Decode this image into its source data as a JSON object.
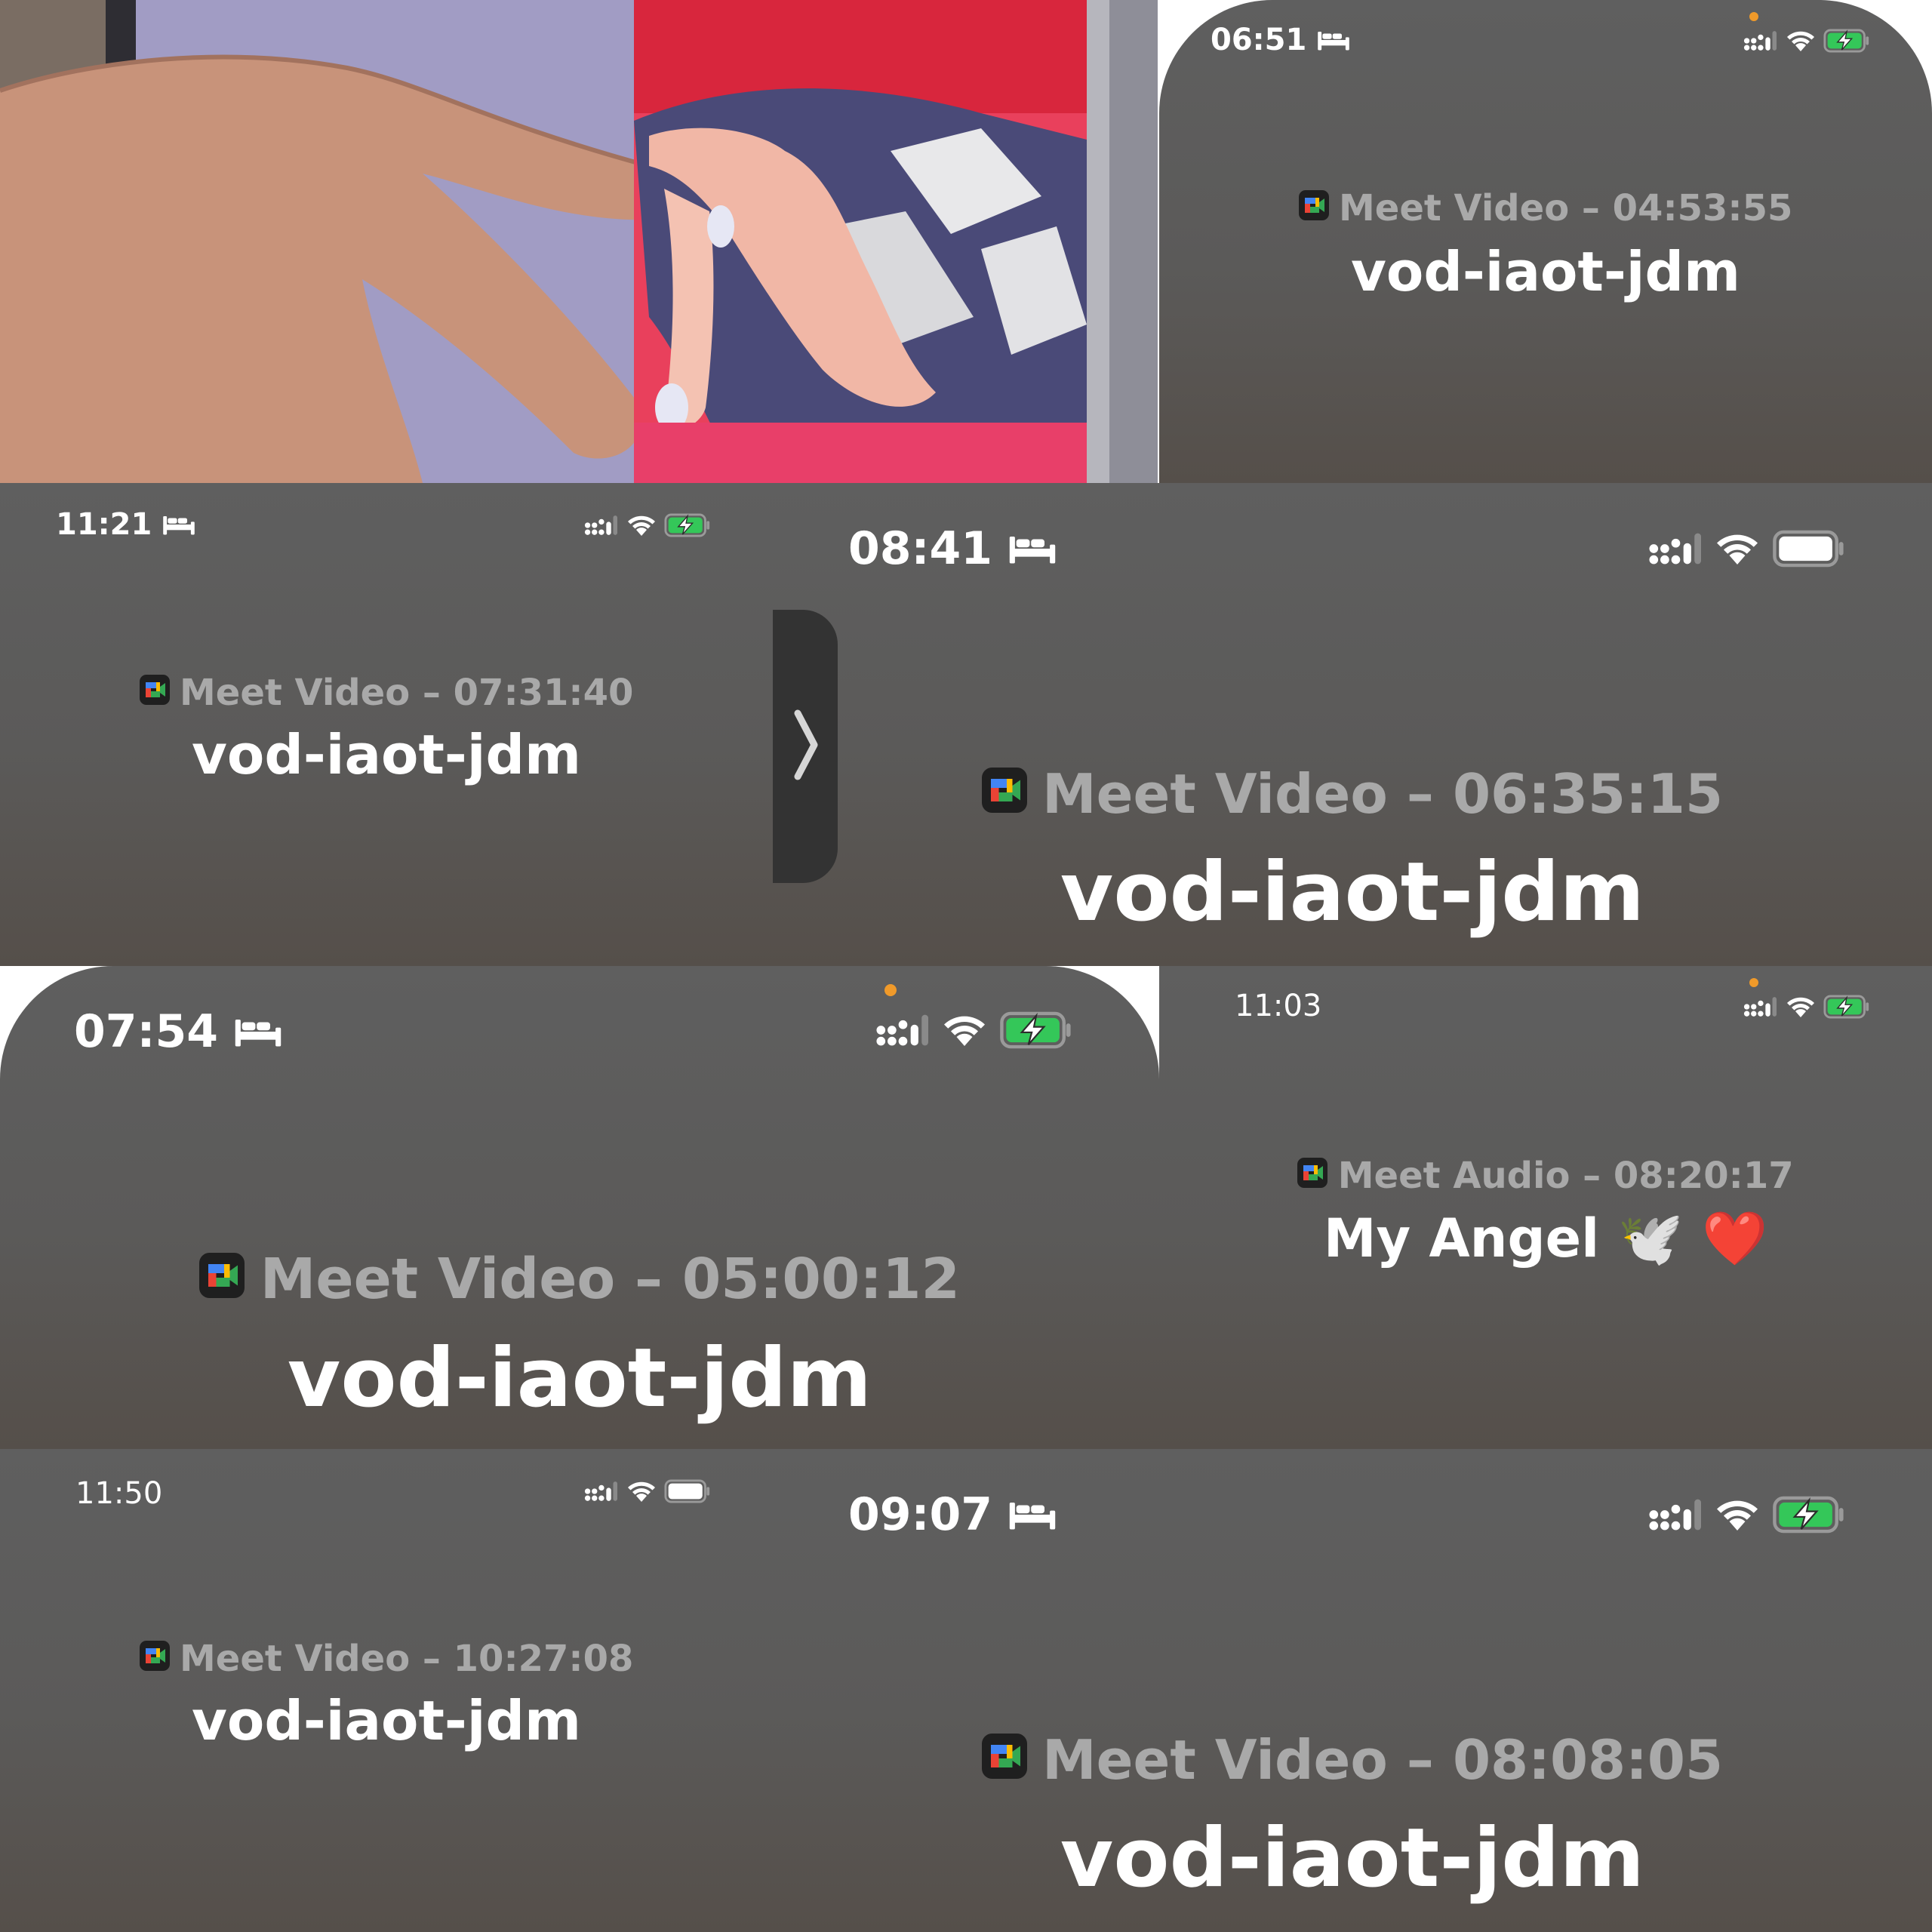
{
  "tiles": {
    "t1": {
      "time": "06:51",
      "app": "Meet Video",
      "sep": "–",
      "duration": "04:53:55",
      "title": "vod-iaot-jdm"
    },
    "t2": {
      "time": "11:21",
      "app": "Meet Video",
      "sep": "–",
      "duration": "07:31:40",
      "title": "vod-iaot-jdm"
    },
    "t3": {
      "time": "08:41",
      "app": "Meet Video",
      "sep": "–",
      "duration": "06:35:15",
      "title": "vod-iaot-jdm"
    },
    "t4": {
      "time": "07:54",
      "app": "Meet Video",
      "sep": "–",
      "duration": "05:00:12",
      "title": "vod-iaot-jdm"
    },
    "t5": {
      "time": "11:03",
      "app": "Meet Audio",
      "sep": "–",
      "duration": "08:20:17",
      "title": "My Angel 🕊️ ❤️"
    },
    "t6": {
      "time": "11:50",
      "app": "Meet Video",
      "sep": "–",
      "duration": "10:27:08",
      "title": "vod-iaot-jdm"
    },
    "t7": {
      "time": "09:07",
      "app": "Meet Video",
      "sep": "–",
      "duration": "08:08:05",
      "title": "vod-iaot-jdm"
    }
  },
  "colors": {
    "tile_bg": "#5d5d5d",
    "caption": "#a9a9a9",
    "title": "#ffffff",
    "battery_charging": "#34c759",
    "mic_dot": "#f09a2a",
    "handle": "#333333"
  },
  "icons": {
    "sleep": "bed-icon",
    "cellular": "cellular-signal-icon",
    "wifi": "wifi-icon",
    "battery": "battery-icon",
    "battery_charging": "battery-charging-icon",
    "app": "google-meet-icon",
    "chevron": "chevron-right-icon"
  }
}
